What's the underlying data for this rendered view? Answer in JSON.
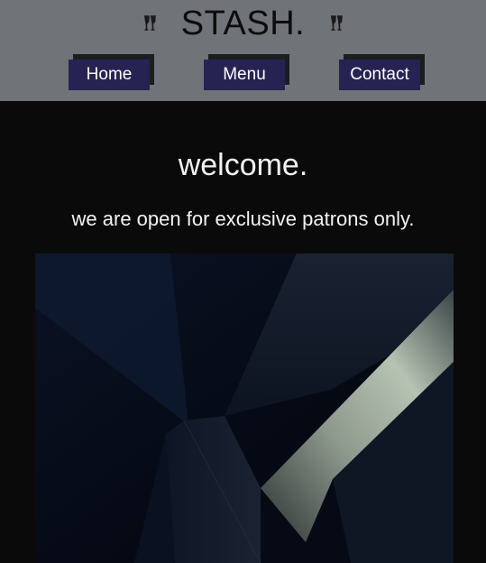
{
  "header": {
    "brand": "STASH.",
    "left_icon": "cocktail-glass-icon",
    "right_icon": "cocktail-glass-icon",
    "background_color": "#707378"
  },
  "nav": {
    "items": [
      {
        "label": "Home"
      },
      {
        "label": "Menu"
      },
      {
        "label": "Contact"
      }
    ],
    "button_color": "#262353"
  },
  "main": {
    "heading": "welcome.",
    "tagline": "we are open for exclusive patrons only.",
    "hero_image": "dark-architecture-photo",
    "background_color": "#0a0a0a"
  }
}
